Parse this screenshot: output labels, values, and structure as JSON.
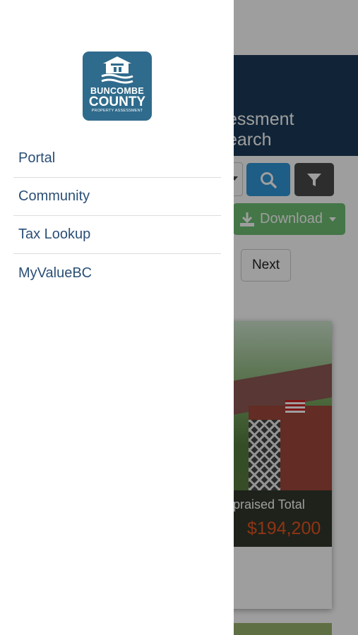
{
  "background": {
    "title_line1": "essment",
    "title_line2": "earch",
    "download_label": "Download",
    "next_label": "Next",
    "card": {
      "appraised_label": "ppraised Total",
      "appraised_value": "$194,200"
    }
  },
  "drawer": {
    "logo": {
      "line1": "BUNCOMBE",
      "line2": "COUNTY",
      "line3": "PROPERTY ASSESSMENT"
    },
    "items": [
      {
        "label": "Portal"
      },
      {
        "label": "Community"
      },
      {
        "label": "Tax Lookup"
      },
      {
        "label": "MyValueBC"
      }
    ]
  },
  "colors": {
    "header_bg": "#1c3a5a",
    "logo_bg": "#2f6b8c",
    "link": "#2a4f77",
    "search_btn": "#2f96d8",
    "filter_btn": "#4a4a4a",
    "download_btn": "#6fbf73",
    "price": "#e8541f"
  },
  "icons": {
    "search": "search-icon",
    "filter": "filter-icon",
    "download": "download-icon",
    "logo": "house-on-water-icon"
  }
}
